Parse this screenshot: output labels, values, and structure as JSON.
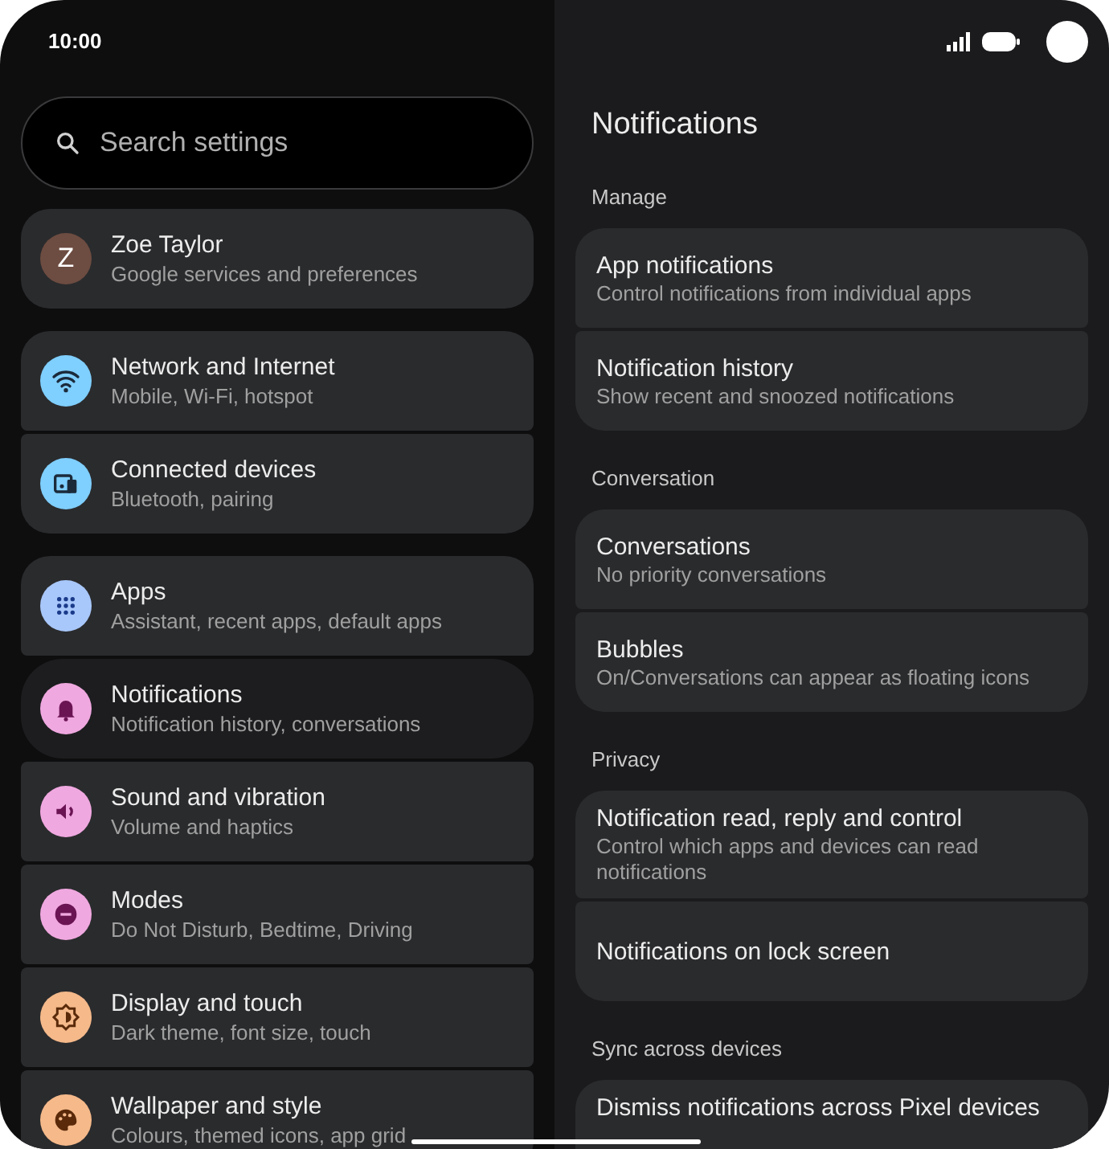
{
  "status_bar": {
    "time": "10:00"
  },
  "search": {
    "placeholder": "Search settings"
  },
  "settings_groups": [
    {
      "items": [
        {
          "kind": "avatar",
          "initial": "Z",
          "title": "Zoe Taylor",
          "subtitle": "Google services and preferences",
          "color": "#6d4c41",
          "selected": false
        }
      ]
    },
    {
      "items": [
        {
          "kind": "wifi",
          "title": "Network and Internet",
          "subtitle": "Mobile, Wi-Fi, hotspot",
          "color": "#7fcfff",
          "selected": false
        },
        {
          "kind": "devices",
          "title": "Connected devices",
          "subtitle": "Bluetooth, pairing",
          "color": "#7fcfff",
          "selected": false
        }
      ]
    },
    {
      "items": [
        {
          "kind": "apps",
          "title": "Apps",
          "subtitle": "Assistant, recent apps, default apps",
          "color": "#a8c7fa",
          "selected": false
        },
        {
          "kind": "bell",
          "title": "Notifications",
          "subtitle": "Notification history, conversations",
          "color": "#f0a8e0",
          "selected": true
        },
        {
          "kind": "speaker",
          "title": "Sound and vibration",
          "subtitle": "Volume and haptics",
          "color": "#f0a8e0",
          "selected": false
        },
        {
          "kind": "minus",
          "title": "Modes",
          "subtitle": "Do Not Disturb, Bedtime, Driving",
          "color": "#f0a8e0",
          "selected": false
        },
        {
          "kind": "brightness",
          "title": "Display and touch",
          "subtitle": "Dark theme, font size, touch",
          "color": "#f5b98a",
          "selected": false
        },
        {
          "kind": "palette",
          "title": "Wallpaper and style",
          "subtitle": "Colours, themed icons, app grid",
          "color": "#f5b98a",
          "selected": false
        }
      ]
    }
  ],
  "detail": {
    "title": "Notifications",
    "sections": [
      {
        "header": "Manage",
        "items": [
          {
            "title": "App notifications",
            "subtitle": "Control notifications from individual apps"
          },
          {
            "title": "Notification history",
            "subtitle": "Show recent and snoozed notifications"
          }
        ]
      },
      {
        "header": "Conversation",
        "items": [
          {
            "title": "Conversations",
            "subtitle": "No priority conversations"
          },
          {
            "title": "Bubbles",
            "subtitle": "On/Conversations can appear as floating icons"
          }
        ]
      },
      {
        "header": "Privacy",
        "items": [
          {
            "title": "Notification read, reply and control",
            "subtitle": "Control which apps and devices can read notifications"
          },
          {
            "title": "Notifications on lock screen"
          }
        ]
      },
      {
        "header": "Sync across devices",
        "items": [
          {
            "title": "Dismiss notifications across Pixel devices"
          }
        ]
      }
    ]
  }
}
